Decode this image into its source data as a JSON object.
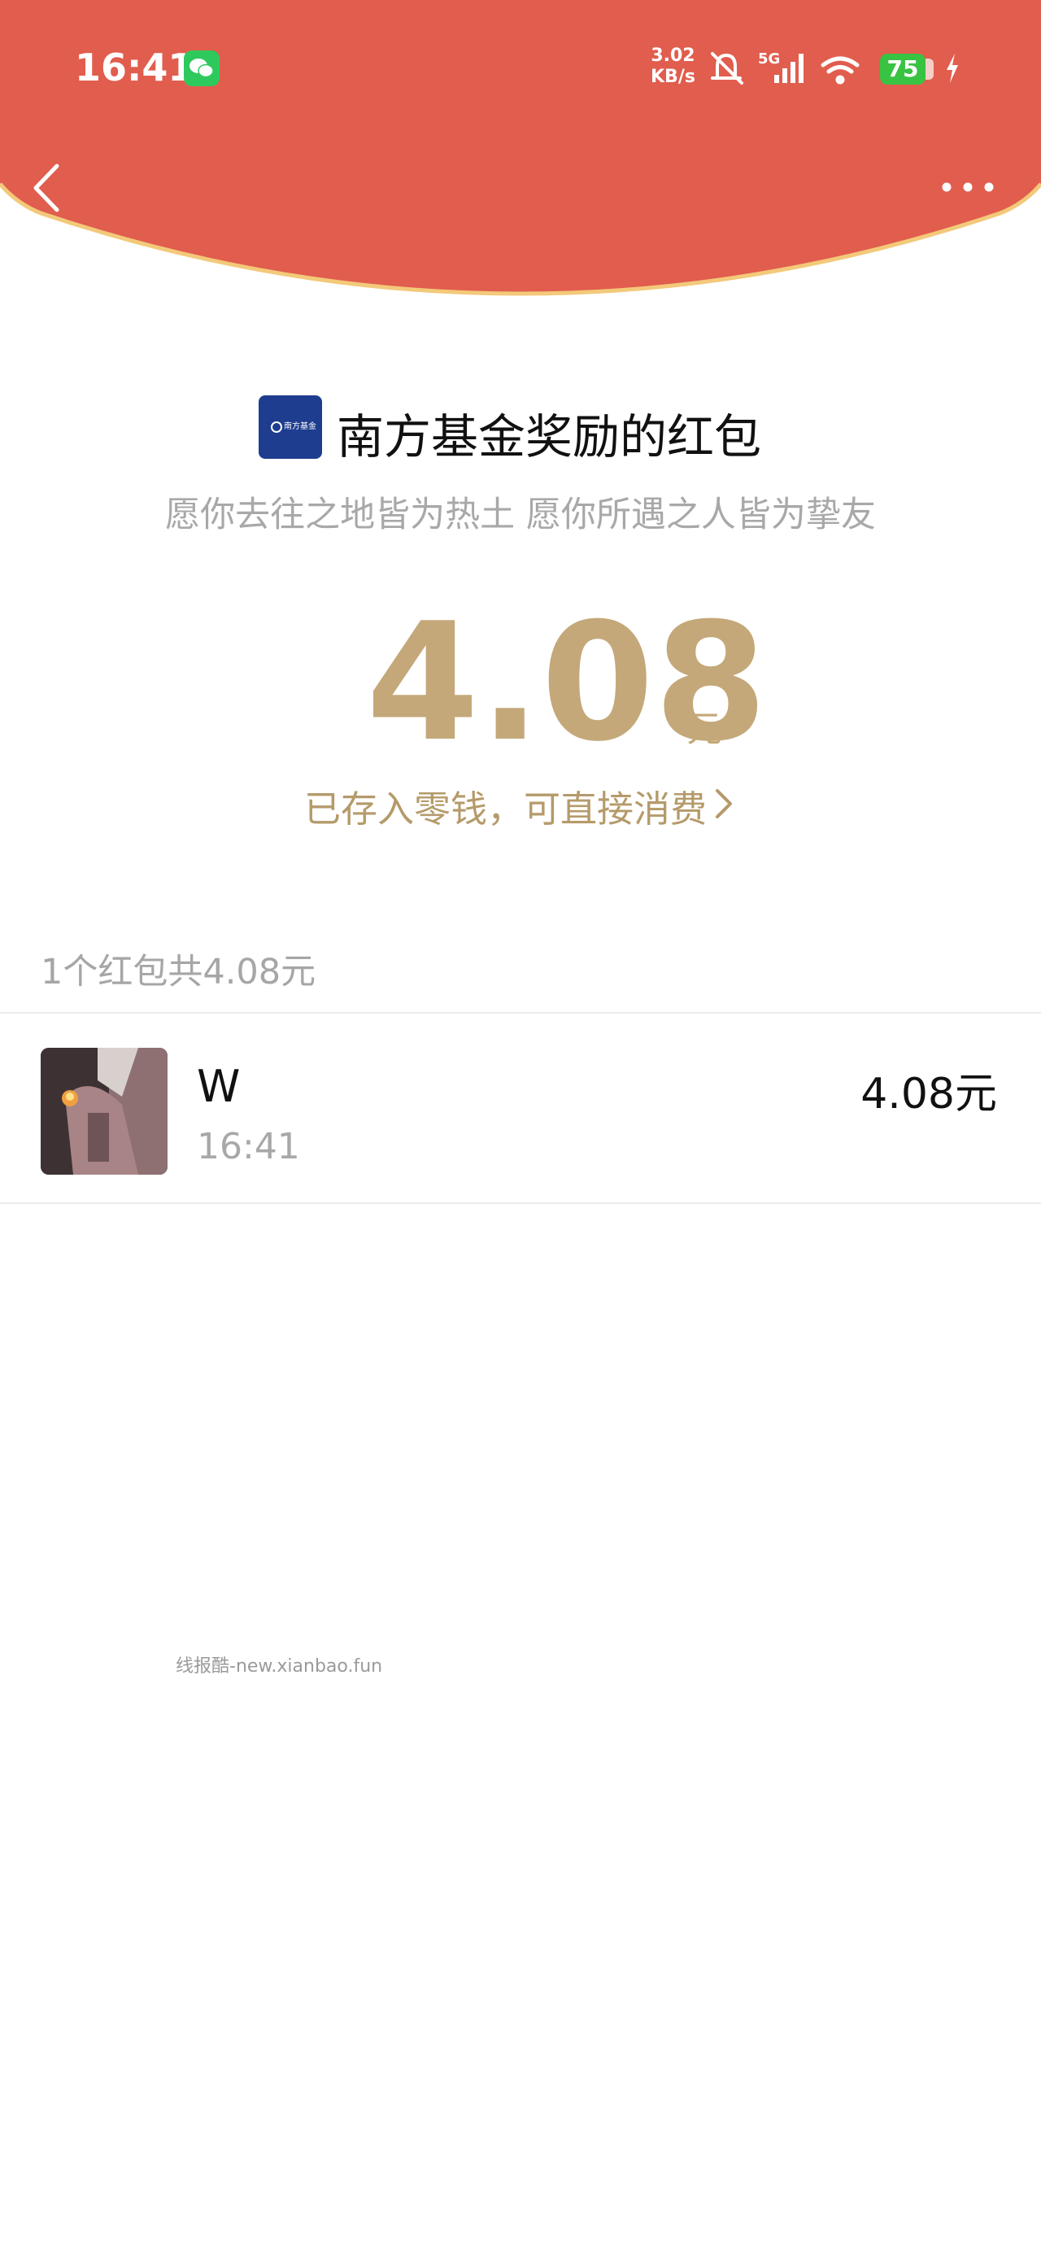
{
  "status_bar": {
    "time": "16:41",
    "net_speed_value": "3.02",
    "net_speed_unit": "KB/s",
    "network": "5G",
    "battery": "75",
    "icons": [
      "wechat-icon",
      "mute-bell-icon",
      "signal-icon",
      "wifi-icon",
      "charging-icon"
    ]
  },
  "nav": {
    "back_icon": "chevron-left-icon",
    "more_icon": "more-dots-icon"
  },
  "sender": {
    "logo_text": "南方基金",
    "title": "南方基金奖励的红包",
    "wish": "愿你去往之地皆为热土 愿你所遇之人皆为挚友"
  },
  "amount": {
    "value": "4.08",
    "unit": "元"
  },
  "change_link": {
    "label": "已存入零钱，可直接消费"
  },
  "summary": "1个红包共4.08元",
  "records": [
    {
      "name": "W",
      "time": "16:41",
      "amount": "4.08元"
    }
  ],
  "watermark": "线报酷-new.xianbao.fun",
  "colors": {
    "header_red": "#e15d4d",
    "header_border": "#f3c97a",
    "gold": "#c4a879"
  }
}
